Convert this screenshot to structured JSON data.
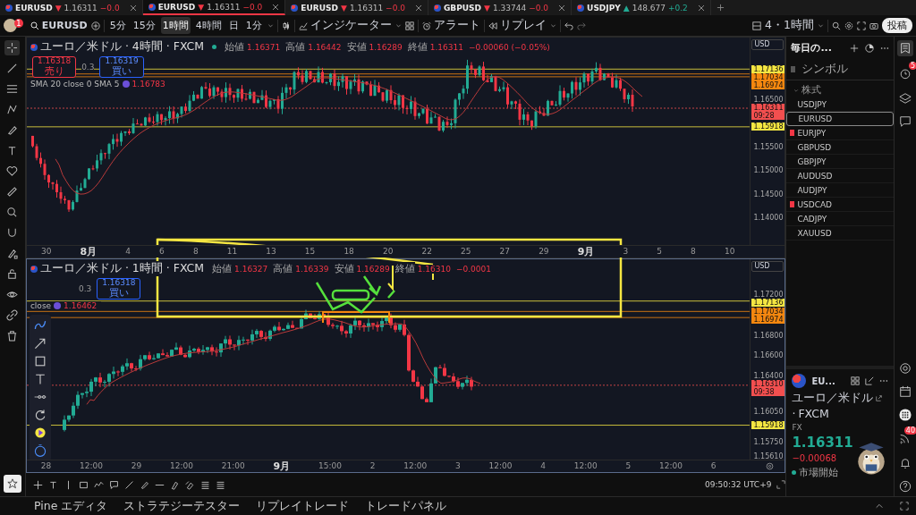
{
  "tabs": [
    {
      "symbol": "EURUSD",
      "arrow": "▼",
      "color": "#f23645",
      "price": "1.16311",
      "change": "−0.0",
      "selected": false
    },
    {
      "symbol": "EURUSD",
      "arrow": "▼",
      "color": "#f23645",
      "price": "1.16311",
      "change": "−0.0",
      "selected": true
    },
    {
      "symbol": "EURUSD",
      "arrow": "▼",
      "color": "#f23645",
      "price": "1.16311",
      "change": "−0.0",
      "selected": false
    },
    {
      "symbol": "GBPUSD",
      "arrow": "▼",
      "color": "#f23645",
      "price": "1.33744",
      "change": "−0.0",
      "selected": false
    },
    {
      "symbol": "USDJPY",
      "arrow": "▲",
      "color": "#22ab94",
      "price": "148.677",
      "change": "+0.2",
      "selected": false
    }
  ],
  "toolbar": {
    "avatar_badge": "1",
    "symbol": "EURUSD",
    "intervals": [
      {
        "label": "5分",
        "selected": false
      },
      {
        "label": "15分",
        "selected": false
      },
      {
        "label": "1時間",
        "selected": true
      },
      {
        "label": "4時間",
        "selected": false
      },
      {
        "label": "日",
        "selected": false
      },
      {
        "label": "1分",
        "selected": false
      }
    ],
    "indicators": "インジケーター",
    "alerts": "アラート",
    "replay": "リプレイ",
    "layout": "4・1時間",
    "publish": "投稿"
  },
  "charts": [
    {
      "title": "ユーロ／米ドル · 4時間 · FXCM",
      "ohlc": [
        {
          "label": "始値",
          "value": "1.16371"
        },
        {
          "label": "高値",
          "value": "1.16442"
        },
        {
          "label": "安値",
          "value": "1.16289"
        },
        {
          "label": "終値",
          "value": "1.16311"
        }
      ],
      "change": "−0.00060 (−0.05%)",
      "sell": {
        "price": "1.16318",
        "label": "売り"
      },
      "spread": "0.3",
      "buy": {
        "price": "1.16319",
        "label": "買い"
      },
      "indicator": "SMA 20 close 0 SMA 5",
      "indicator_value": "1.16783",
      "currency": "USD",
      "price_axis": [
        {
          "label": "1.17136",
          "kind": "tag",
          "color": "#f5e642"
        },
        {
          "label": "1.17034",
          "kind": "tag",
          "color": "#f5870f"
        },
        {
          "label": "1.16974",
          "kind": "tag",
          "color": "#f5870f"
        },
        {
          "label": "1.16500",
          "kind": "plain"
        },
        {
          "label": "1.16311",
          "time": "09:28",
          "kind": "tag",
          "color": "#f24f4f"
        },
        {
          "label": "1.15918",
          "kind": "tag",
          "color": "#f5e642"
        },
        {
          "label": "1.15500",
          "kind": "plain"
        },
        {
          "label": "1.15000",
          "kind": "plain"
        },
        {
          "label": "1.14500",
          "kind": "plain"
        },
        {
          "label": "1.14000",
          "kind": "plain"
        }
      ],
      "time_axis": [
        {
          "label": "30",
          "kind": "day"
        },
        {
          "label": "8月",
          "kind": "month"
        },
        {
          "label": "4",
          "kind": "day"
        },
        {
          "label": "6",
          "kind": "day"
        },
        {
          "label": "8",
          "kind": "day"
        },
        {
          "label": "11",
          "kind": "day"
        },
        {
          "label": "13",
          "kind": "day"
        },
        {
          "label": "15",
          "kind": "day"
        },
        {
          "label": "18",
          "kind": "day"
        },
        {
          "label": "20",
          "kind": "day"
        },
        {
          "label": "22",
          "kind": "day"
        },
        {
          "label": "25",
          "kind": "day"
        },
        {
          "label": "27",
          "kind": "day"
        },
        {
          "label": "29",
          "kind": "day"
        },
        {
          "label": "9月",
          "kind": "month"
        },
        {
          "label": "3",
          "kind": "day"
        },
        {
          "label": "5",
          "kind": "day"
        },
        {
          "label": "8",
          "kind": "day"
        },
        {
          "label": "10",
          "kind": "day"
        }
      ]
    },
    {
      "title": "ユーロ／米ドル · 1時間 · FXCM",
      "ohlc": [
        {
          "label": "始値",
          "value": "1.16327"
        },
        {
          "label": "高値",
          "value": "1.16339"
        },
        {
          "label": "安値",
          "value": "1.16289"
        },
        {
          "label": "終値",
          "value": "1.16310"
        }
      ],
      "change": "−0.0001",
      "spread": "0.3",
      "buy": {
        "price": "1.16318",
        "label": "買い"
      },
      "indicator": "close",
      "indicator_value": "1.16462",
      "currency": "USD",
      "price_axis": [
        {
          "label": "1.17200",
          "kind": "plain"
        },
        {
          "label": "1.17136",
          "kind": "tag",
          "color": "#f5e642"
        },
        {
          "label": "1.17034",
          "kind": "tag",
          "color": "#f5870f"
        },
        {
          "label": "1.16974",
          "kind": "tag",
          "color": "#f5870f"
        },
        {
          "label": "1.16800",
          "kind": "plain"
        },
        {
          "label": "1.16600",
          "kind": "plain"
        },
        {
          "label": "1.16400",
          "kind": "plain"
        },
        {
          "label": "1.16310",
          "time": "09:38",
          "kind": "tag",
          "color": "#f24f4f"
        },
        {
          "label": "1.16050",
          "kind": "plain"
        },
        {
          "label": "1.15918",
          "kind": "tag",
          "color": "#f5e642"
        },
        {
          "label": "1.15750",
          "kind": "plain"
        },
        {
          "label": "1.15610",
          "kind": "plain"
        }
      ],
      "time_axis": [
        {
          "label": "28",
          "kind": "day"
        },
        {
          "label": "12:00",
          "kind": "day"
        },
        {
          "label": "29",
          "kind": "day"
        },
        {
          "label": "12:00",
          "kind": "day"
        },
        {
          "label": "21:00",
          "kind": "day"
        },
        {
          "label": "9月",
          "kind": "month"
        },
        {
          "label": "15:00",
          "kind": "day"
        },
        {
          "label": "2",
          "kind": "day"
        },
        {
          "label": "12:00",
          "kind": "day"
        },
        {
          "label": "3",
          "kind": "day"
        },
        {
          "label": "12:00",
          "kind": "day"
        },
        {
          "label": "4",
          "kind": "day"
        },
        {
          "label": "12:00",
          "kind": "day"
        },
        {
          "label": "5",
          "kind": "day"
        },
        {
          "label": "12:00",
          "kind": "day"
        },
        {
          "label": "6",
          "kind": "day"
        }
      ]
    }
  ],
  "clock": "09:50:32 UTC+9",
  "watchlist": {
    "title": "毎日の...",
    "header": "シンボル",
    "section": {
      "label": "株式",
      "expanded": true
    },
    "items": [
      {
        "symbol": "USDJPY",
        "selected": false,
        "flagged": false
      },
      {
        "symbol": "EURUSD",
        "selected": true,
        "flagged": false
      },
      {
        "symbol": "EURJPY",
        "selected": false,
        "flagged": true
      },
      {
        "symbol": "GBPUSD",
        "selected": false,
        "flagged": false
      },
      {
        "symbol": "GBPJPY",
        "selected": false,
        "flagged": false
      },
      {
        "symbol": "AUDUSD",
        "selected": false,
        "flagged": false
      },
      {
        "symbol": "AUDJPY",
        "selected": false,
        "flagged": false
      },
      {
        "symbol": "USDCAD",
        "selected": false,
        "flagged": true
      },
      {
        "symbol": "CADJPY",
        "selected": false,
        "flagged": false
      },
      {
        "symbol": "XAUUSD",
        "selected": false,
        "flagged": false
      }
    ]
  },
  "detail": {
    "symbol": "EU...",
    "name": "ユーロ／米ドル",
    "separator": "·",
    "exchange": "FXCM",
    "type": "FX",
    "price": "1.16311",
    "change": "−0.00068",
    "status": "市場開始"
  },
  "side_badges": {
    "alerts": "5",
    "feed": "40"
  },
  "bottom_tabs": [
    "Pine エディタ",
    "ストラテジーテスター",
    "リプレイトレード",
    "トレードパネル"
  ]
}
